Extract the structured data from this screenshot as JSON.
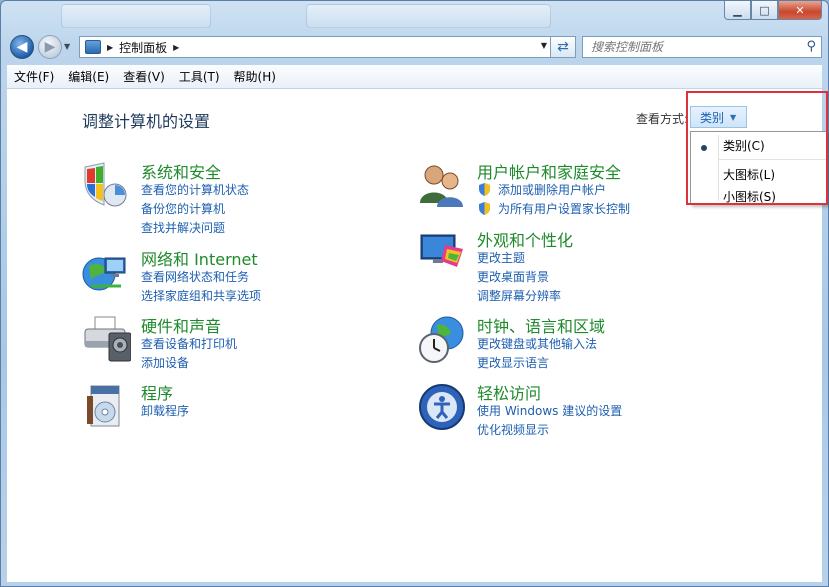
{
  "window": {
    "controls": {
      "minimize": "▁",
      "maximize": "□",
      "close": "✕"
    }
  },
  "address": {
    "crumb": "控制面板",
    "search_placeholder": "搜索控制面板"
  },
  "menubar": [
    "文件(F)",
    "编辑(E)",
    "查看(V)",
    "工具(T)",
    "帮助(H)"
  ],
  "content": {
    "heading": "调整计算机的设置",
    "view_label": "查看方式:",
    "view_value": "类别"
  },
  "categories": [
    {
      "title": "系统和安全",
      "links": [
        "查看您的计算机状态",
        "备份您的计算机",
        "查找并解决问题"
      ]
    },
    {
      "title": "网络和 Internet",
      "links": [
        "查看网络状态和任务",
        "选择家庭组和共享选项"
      ]
    },
    {
      "title": "硬件和声音",
      "links": [
        "查看设备和打印机",
        "添加设备"
      ]
    },
    {
      "title": "程序",
      "links": [
        "卸载程序"
      ]
    },
    {
      "title": "用户帐户和家庭安全",
      "links": [
        "添加或删除用户帐户",
        "为所有用户设置家长控制"
      ]
    },
    {
      "title": "外观和个性化",
      "links": [
        "更改主题",
        "更改桌面背景",
        "调整屏幕分辨率"
      ]
    },
    {
      "title": "时钟、语言和区域",
      "links": [
        "更改键盘或其他输入法",
        "更改显示语言"
      ]
    },
    {
      "title": "轻松访问",
      "links": [
        "使用 Windows 建议的设置",
        "优化视频显示"
      ]
    }
  ],
  "view_menu": {
    "items": [
      "类别(C)",
      "大图标(L)",
      "小图标(S)"
    ],
    "selected": "类别(C)"
  }
}
